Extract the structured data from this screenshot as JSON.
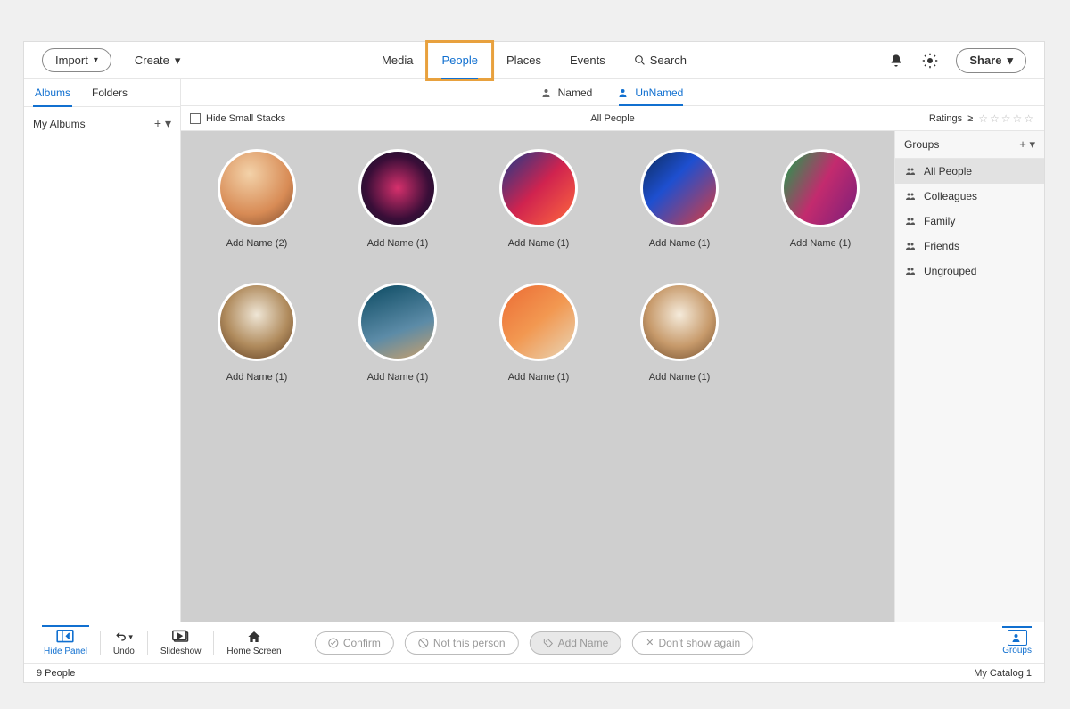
{
  "topbar": {
    "import": "Import",
    "create": "Create",
    "share": "Share"
  },
  "nav": {
    "media": "Media",
    "people": "People",
    "places": "Places",
    "events": "Events",
    "search": "Search"
  },
  "leftPanel": {
    "tab_albums": "Albums",
    "tab_folders": "Folders",
    "my_albums": "My Albums"
  },
  "subnav": {
    "named": "Named",
    "unnamed": "UnNamed"
  },
  "filterbar": {
    "hide_small": "Hide Small Stacks",
    "all_people": "All People",
    "ratings": "Ratings",
    "gte": "≥"
  },
  "people": [
    {
      "label": "Add Name",
      "count": 2
    },
    {
      "label": "Add Name",
      "count": 1
    },
    {
      "label": "Add Name",
      "count": 1
    },
    {
      "label": "Add Name",
      "count": 1
    },
    {
      "label": "Add Name",
      "count": 1
    },
    {
      "label": "Add Name",
      "count": 1
    },
    {
      "label": "Add Name",
      "count": 1
    },
    {
      "label": "Add Name",
      "count": 1
    },
    {
      "label": "Add Name",
      "count": 1
    }
  ],
  "groupsPanel": {
    "header": "Groups",
    "items": [
      "All People",
      "Colleagues",
      "Family",
      "Friends",
      "Ungrouped"
    ],
    "selectedIndex": 0
  },
  "bottombar": {
    "hide_panel": "Hide Panel",
    "undo": "Undo",
    "slideshow": "Slideshow",
    "home": "Home Screen",
    "confirm": "Confirm",
    "not_this_person": "Not this person",
    "add_name": "Add Name",
    "dont_show": "Don't show again",
    "groups": "Groups"
  },
  "statusbar": {
    "count": "9 People",
    "catalog": "My Catalog 1"
  }
}
